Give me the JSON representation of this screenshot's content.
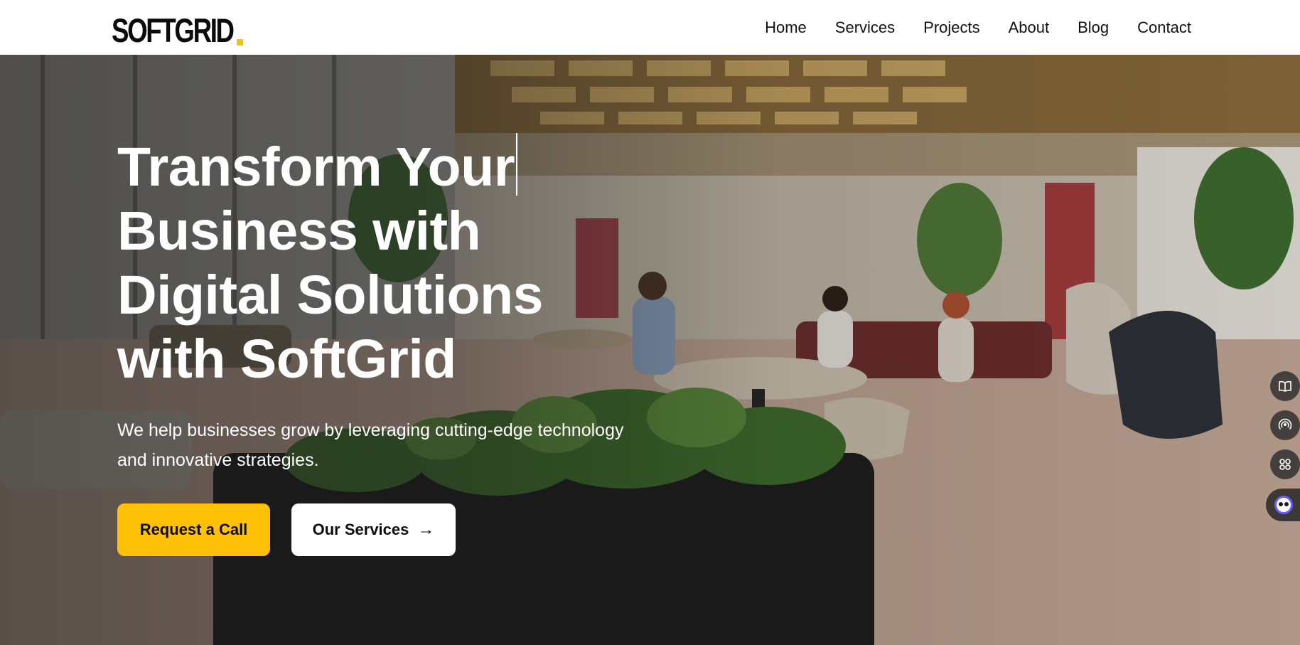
{
  "header": {
    "logo_text": "SOFTGRID",
    "nav": [
      "Home",
      "Services",
      "Projects",
      "About",
      "Blog",
      "Contact"
    ]
  },
  "hero": {
    "title_lines": [
      "Transform Your",
      "Business with",
      "Digital Solutions",
      "with SoftGrid"
    ],
    "subtitle": "We help businesses grow by leveraging cutting-edge technology and innovative strategies.",
    "primary_button": "Request a Call",
    "secondary_button": "Our Services",
    "secondary_button_icon": "arrow-right-icon"
  },
  "side_widget": {
    "icons": [
      "book-open-icon",
      "broadcast-icon",
      "apps-grid-icon",
      "assistant-bot-icon"
    ]
  },
  "colors": {
    "accent": "#ffc107",
    "header_bg": "#ffffff",
    "text_light": "#ffffff",
    "text_dark": "#111111"
  }
}
